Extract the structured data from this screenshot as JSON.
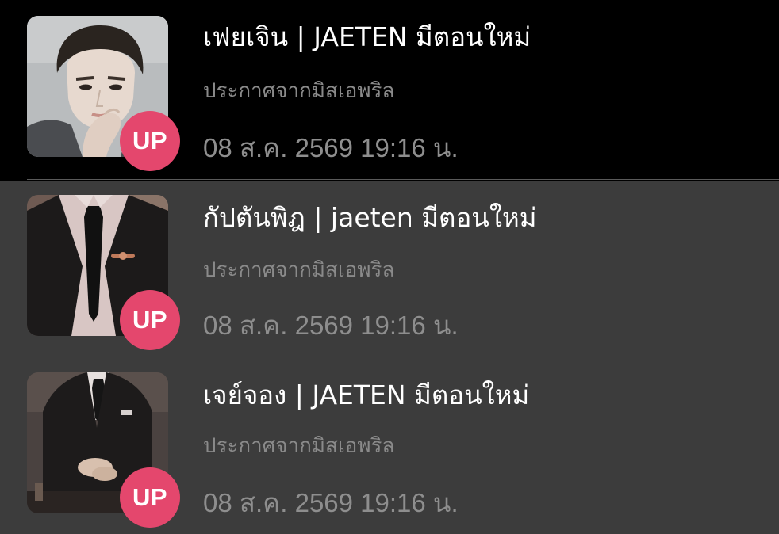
{
  "notifications": [
    {
      "title": "เฟยเจิน | JAETEN มีตอนใหม่",
      "subtitle": "ประกาศจากมิสเอพริล",
      "date": "08 ส.ค. 2569 19:16 น.",
      "badge": "UP",
      "thumbnail_icon": "portrait-man-hand-on-lips-icon"
    },
    {
      "title": "กัปตันพิฎ | jaeten มีตอนใหม่",
      "subtitle": "ประกาศจากมิสเอพริล",
      "date": "08 ส.ค. 2569 19:16 น.",
      "badge": "UP",
      "thumbnail_icon": "suit-and-tie-icon"
    },
    {
      "title": "เจย์จอง | JAETEN มีตอนใหม่",
      "subtitle": "ประกาศจากมิสเอพริล",
      "date": "08 ส.ค. 2569 19:16 น.",
      "badge": "UP",
      "thumbnail_icon": "seated-man-in-suit-icon"
    }
  ],
  "colors": {
    "badge": "#e4476d",
    "selected_row_bg": "#000000",
    "row_bg": "#3c3c3c",
    "title_text": "#ffffff",
    "secondary_text": "#8a8a8a"
  }
}
